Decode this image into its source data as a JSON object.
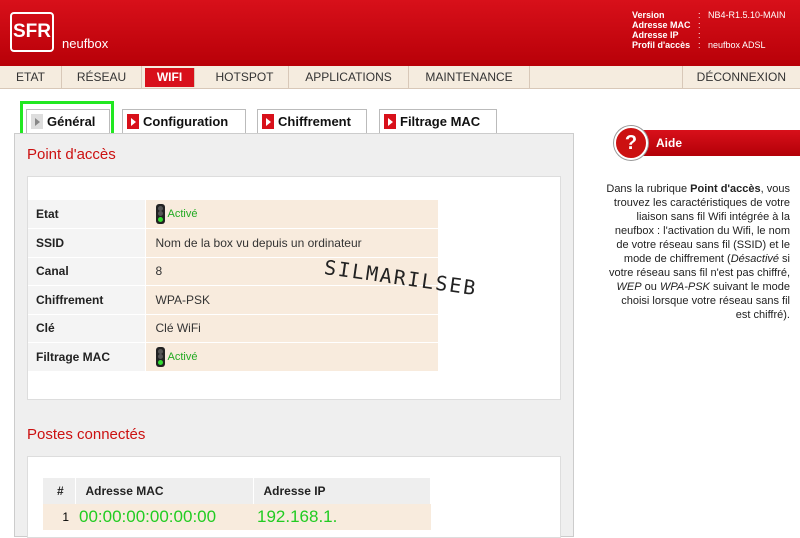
{
  "header": {
    "logo_text": "SFR",
    "logo_sub": "neufbox",
    "info": [
      {
        "key": "Version",
        "value": "NB4-R1.5.10-MAIN"
      },
      {
        "key": "Adresse MAC",
        "value": ""
      },
      {
        "key": "Adresse IP",
        "value": ""
      },
      {
        "key": "Profil d'accès",
        "value": "neufbox ADSL"
      }
    ]
  },
  "nav": {
    "items": [
      "ETAT",
      "RÉSEAU",
      "WIFI",
      "HOTSPOT",
      "APPLICATIONS",
      "MAINTENANCE"
    ],
    "active": "WIFI",
    "logout": "DÉCONNEXION"
  },
  "tabs": [
    "Général",
    "Configuration",
    "Chiffrement",
    "Filtrage MAC"
  ],
  "access_point": {
    "title": "Point d'accès",
    "rows": [
      {
        "label": "Etat",
        "value": "Activé"
      },
      {
        "label": "SSID",
        "value": "Nom de la box vu depuis un ordinateur"
      },
      {
        "label": "Canal",
        "value": "8"
      },
      {
        "label": "Chiffrement",
        "value": "WPA-PSK"
      },
      {
        "label": "Clé",
        "value": "Clé WiFi"
      },
      {
        "label": "Filtrage MAC",
        "value": "Activé"
      }
    ]
  },
  "watermark": "SILMARILSEB",
  "clients": {
    "title": "Postes connectés",
    "headers": [
      "#",
      "Adresse MAC",
      "Adresse IP"
    ],
    "rows": [
      {
        "n": "1",
        "mac": "00:00:00:00:00:00",
        "ip": "192.168.1."
      }
    ]
  },
  "help": {
    "title": "Aide",
    "icon_char": "?",
    "t1": "Dans la rubrique ",
    "b1": "Point d'accès",
    "t2": ", vous trouvez les caractéristiques de votre liaison sans fil Wifi intégrée à la neufbox : l'activation du Wifi, le nom de votre réseau sans fil (SSID) et le mode de chiffrement (",
    "i1": "Désactivé",
    "t3": " si votre réseau sans fil n'est pas chiffré, ",
    "i2": "WEP",
    "t4": " ou ",
    "i3": "WPA-PSK",
    "t5": " suivant le mode choisi lorsque votre réseau sans fil est chiffré)."
  },
  "colors": {
    "brand_red": "#d8101a",
    "highlight_green": "#21e821"
  }
}
